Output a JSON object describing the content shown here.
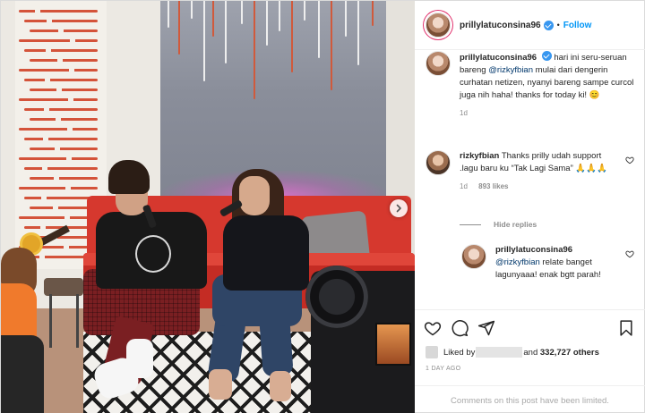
{
  "post": {
    "username": "prillylatuconsina96",
    "follow_label": "Follow",
    "separator": "•",
    "caption": {
      "username": "prillylatuconsina96",
      "text_before": " hari ini seru-seruan bareng ",
      "mention": "@rizkyfbian",
      "text_after": " mulai dari dengerin curhatan netizen, nyanyi bareng sampe curcol juga nih haha! thanks for today ki! 😊",
      "age": "1d"
    },
    "comments": [
      {
        "username": "rizkyfbian",
        "text": " Thanks prilly udah support .lagu baru ku “Tak Lagi Sama” 🙏🙏🙏",
        "age": "1d",
        "likes": "893 likes"
      }
    ],
    "hide_replies_label": "Hide replies",
    "reply": {
      "username": "prillylatuconsina96",
      "mention": "@rizkyfbian",
      "text": " relate banget lagunyaaa! enak bgtt parah!"
    },
    "liked_by_prefix": "Liked by",
    "liked_by_suffix": "and",
    "liked_by_count": "332,727 others",
    "timestamp": "1 DAY AGO",
    "comments_limited": "Comments on this post have been limited."
  },
  "icons": {
    "heart": "heart-icon",
    "comment": "comment-icon",
    "share": "share-icon",
    "bookmark": "bookmark-icon",
    "next": "chevron-right-icon",
    "verified": "verified-badge-icon"
  },
  "colors": {
    "link": "#0095f6",
    "verified": "#3897f0",
    "muted": "#8e8e8e",
    "text": "#262626"
  }
}
